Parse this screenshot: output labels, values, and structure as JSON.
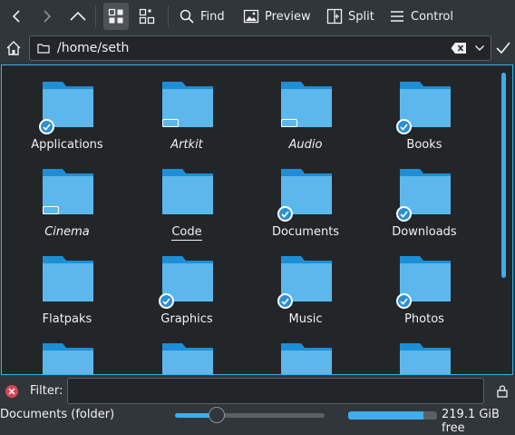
{
  "toolbar": {
    "find_label": "Find",
    "preview_label": "Preview",
    "split_label": "Split",
    "control_label": "Control"
  },
  "location": {
    "path": "/home/seth"
  },
  "folders": [
    {
      "name": "Applications",
      "badge": "check",
      "italic": false
    },
    {
      "name": "Artkit",
      "badge": "link",
      "italic": true
    },
    {
      "name": "Audio",
      "badge": "link",
      "italic": true
    },
    {
      "name": "Books",
      "badge": "check",
      "italic": false
    },
    {
      "name": "Cinema",
      "badge": "link",
      "italic": true
    },
    {
      "name": "Code",
      "badge": "none",
      "italic": false,
      "underlined": true
    },
    {
      "name": "Documents",
      "badge": "check",
      "italic": false
    },
    {
      "name": "Downloads",
      "badge": "check",
      "italic": false
    },
    {
      "name": "Flatpaks",
      "badge": "none",
      "italic": false
    },
    {
      "name": "Graphics",
      "badge": "check",
      "italic": false
    },
    {
      "name": "Music",
      "badge": "check",
      "italic": false
    },
    {
      "name": "Photos",
      "badge": "check",
      "italic": false
    },
    {
      "name": "",
      "badge": "none",
      "italic": false
    },
    {
      "name": "",
      "badge": "none",
      "italic": false
    },
    {
      "name": "",
      "badge": "none",
      "italic": false
    },
    {
      "name": "",
      "badge": "none",
      "italic": false
    }
  ],
  "filter": {
    "label": "Filter:",
    "value": ""
  },
  "status": {
    "text": "Documents (folder)",
    "zoom_fraction": 0.28,
    "space_used_fraction": 0.85,
    "free_text": "219.1 GiB free"
  },
  "colors": {
    "accent": "#3daee9",
    "folder_body": "#5cb8ec",
    "folder_tab": "#1d8fd6",
    "background": "#31363b",
    "view_background": "#232629"
  }
}
